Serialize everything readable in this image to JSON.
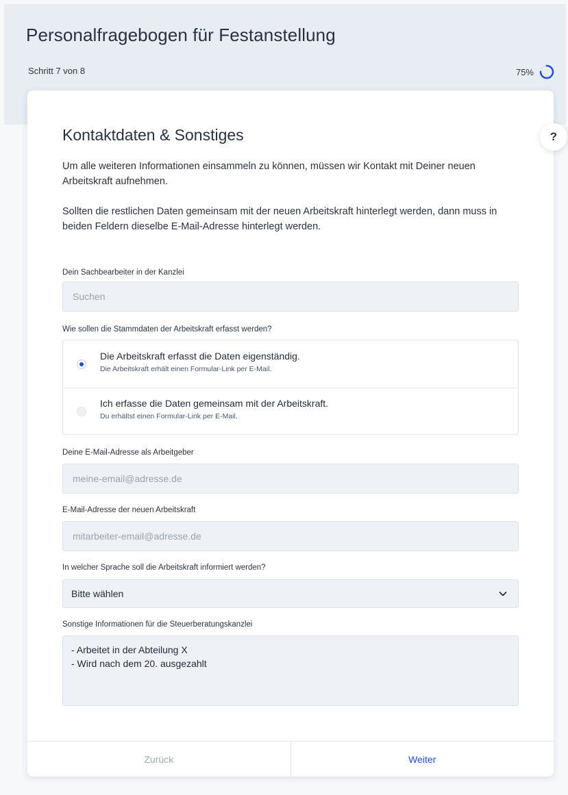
{
  "header": {
    "title": "Personalfragebogen für Festanstellung",
    "step": "Schritt 7 von 8",
    "progress_label": "75%",
    "progress_value": 0.75
  },
  "help": {
    "label": "?"
  },
  "section": {
    "title": "Kontaktdaten & Sonstiges",
    "intro_1": "Um alle weiteren Informationen einsammeln zu können, müssen wir Kontakt mit Deiner neuen Arbeitskraft aufnehmen.",
    "intro_2": "Sollten die restlichen Daten gemeinsam mit der neuen Arbeitskraft hinterlegt werden, dann muss in beiden Feldern dieselbe E-Mail-Adresse hinterlegt werden."
  },
  "fields": {
    "advisor": {
      "label": "Dein Sachbearbeiter in der Kanzlei",
      "placeholder": "Suchen",
      "value": ""
    },
    "master_data": {
      "label": "Wie sollen die Stammdaten der Arbeitskraft erfasst werden?",
      "options": [
        {
          "title": "Die Arbeitskraft erfasst die Daten eigenständig.",
          "subtitle": "Die Arbeitskraft erhält einen Formular-Link per E-Mail.",
          "selected": true
        },
        {
          "title": "Ich erfasse die Daten gemeinsam mit der Arbeitskraft.",
          "subtitle": "Du erhältst einen Formular-Link per E-Mail.",
          "selected": false
        }
      ]
    },
    "employer_email": {
      "label": "Deine E-Mail-Adresse als Arbeitgeber",
      "placeholder": "meine-email@adresse.de",
      "value": ""
    },
    "employee_email": {
      "label": "E-Mail-Adresse der neuen Arbeitskraft",
      "placeholder": "mitarbeiter-email@adresse.de",
      "value": ""
    },
    "language": {
      "label": "In welcher Sprache soll die Arbeitskraft informiert werden?",
      "selected": "Bitte wählen"
    },
    "notes": {
      "label": "Sonstige Informationen für die Steuerberatungskanzlei",
      "lines": [
        "- Arbeitet in der Abteilung X",
        "- Wird nach dem 20. ausgezahlt"
      ]
    }
  },
  "footer": {
    "back_label": "Zurück",
    "next_label": "Weiter"
  },
  "colors": {
    "accent": "#1d4ed8",
    "input_bg": "#eef1f5",
    "header_band": "#e8edf3"
  }
}
